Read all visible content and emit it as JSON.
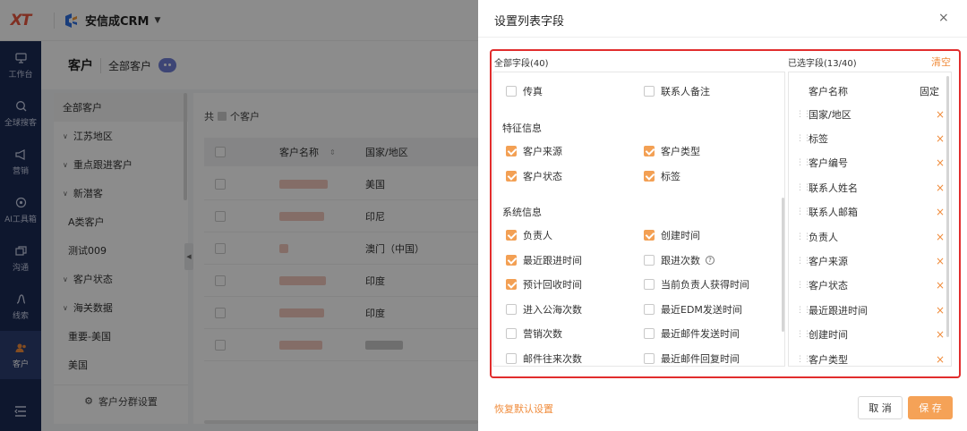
{
  "app": {
    "logo": "XT",
    "brand": "安信成CRM"
  },
  "nav": [
    {
      "label": "工作台",
      "icon": "monitor-icon"
    },
    {
      "label": "全球搜客",
      "icon": "search-icon"
    },
    {
      "label": "营销",
      "icon": "megaphone-icon"
    },
    {
      "label": "AI工具箱",
      "icon": "ai-toolbox-icon"
    },
    {
      "label": "沟通",
      "icon": "chat-icon"
    },
    {
      "label": "线索",
      "icon": "lead-icon"
    },
    {
      "label": "客户",
      "icon": "customer-icon"
    }
  ],
  "page": {
    "title": "客户",
    "subtitle": "全部客户"
  },
  "groups": {
    "items": [
      {
        "label": "全部客户"
      },
      {
        "label": "江苏地区"
      },
      {
        "label": "重点跟进客户"
      },
      {
        "label": "新潜客"
      },
      {
        "label": "A类客户"
      },
      {
        "label": "测试009"
      },
      {
        "label": "客户状态"
      },
      {
        "label": "海关数据"
      },
      {
        "label": "重要-美国"
      },
      {
        "label": "美国"
      }
    ],
    "footer": "客户分群设置"
  },
  "table": {
    "total_prefix": "共",
    "total_suffix": "个客户",
    "col_name": "客户名称",
    "col_country": "国家/地区",
    "countries": [
      "美国",
      "印尼",
      "澳门（中国）",
      "印度",
      "印度",
      ""
    ]
  },
  "dialog": {
    "title": "设置列表字段",
    "close": "×",
    "all_label": "全部字段(40)",
    "selected_label": "已选字段(13/40)",
    "clear": "清空",
    "fields_top": [
      {
        "label": "传真",
        "checked": false
      },
      {
        "label": "联系人备注",
        "checked": false
      }
    ],
    "section_feature": "特征信息",
    "fields_feature": [
      {
        "label": "客户来源",
        "checked": true
      },
      {
        "label": "客户类型",
        "checked": true
      },
      {
        "label": "客户状态",
        "checked": true
      },
      {
        "label": "标签",
        "checked": true
      }
    ],
    "section_system": "系统信息",
    "fields_system": [
      {
        "label": "负责人",
        "checked": true
      },
      {
        "label": "创建时间",
        "checked": true
      },
      {
        "label": "最近跟进时间",
        "checked": true
      },
      {
        "label": "跟进次数",
        "checked": false
      },
      {
        "label": "预计回收时间",
        "checked": true
      },
      {
        "label": "当前负责人获得时间",
        "checked": false
      },
      {
        "label": "进入公海次数",
        "checked": false
      },
      {
        "label": "最近EDM发送时间",
        "checked": false
      },
      {
        "label": "营销次数",
        "checked": false
      },
      {
        "label": "最近邮件发送时间",
        "checked": false
      },
      {
        "label": "邮件往来次数",
        "checked": false
      },
      {
        "label": "最近邮件回复时间",
        "checked": false
      }
    ],
    "selected_head": "客户名称",
    "selected_fixed": "固定",
    "selected": [
      "国家/地区",
      "标签",
      "客户编号",
      "联系人姓名",
      "联系人邮箱",
      "负责人",
      "客户来源",
      "客户状态",
      "最近跟进时间",
      "创建时间",
      "客户类型"
    ],
    "remove_glyph": "×",
    "restore": "恢复默认设置",
    "cancel": "取 消",
    "save": "保 存"
  },
  "colors": {
    "accent": "#f5a257",
    "highlight_box": "#e12d2d",
    "nav_bg": "#1b2a55"
  }
}
